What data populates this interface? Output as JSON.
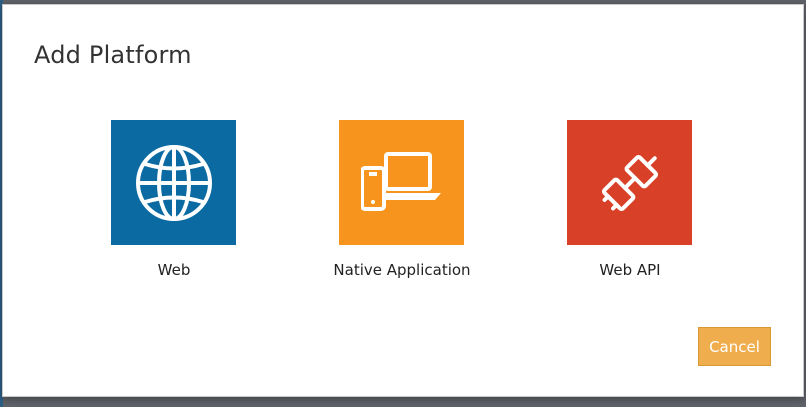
{
  "dialog": {
    "title": "Add Platform",
    "platforms": [
      {
        "label": "Web",
        "icon": "globe-icon",
        "color": "#0b6aa2"
      },
      {
        "label": "Native Application",
        "icon": "devices-icon",
        "color": "#f7941d"
      },
      {
        "label": "Web API",
        "icon": "plug-icon",
        "color": "#d84027"
      }
    ],
    "cancel_label": "Cancel"
  },
  "colors": {
    "accent_button": "#f0ad4e",
    "backdrop": "#5f6369"
  }
}
